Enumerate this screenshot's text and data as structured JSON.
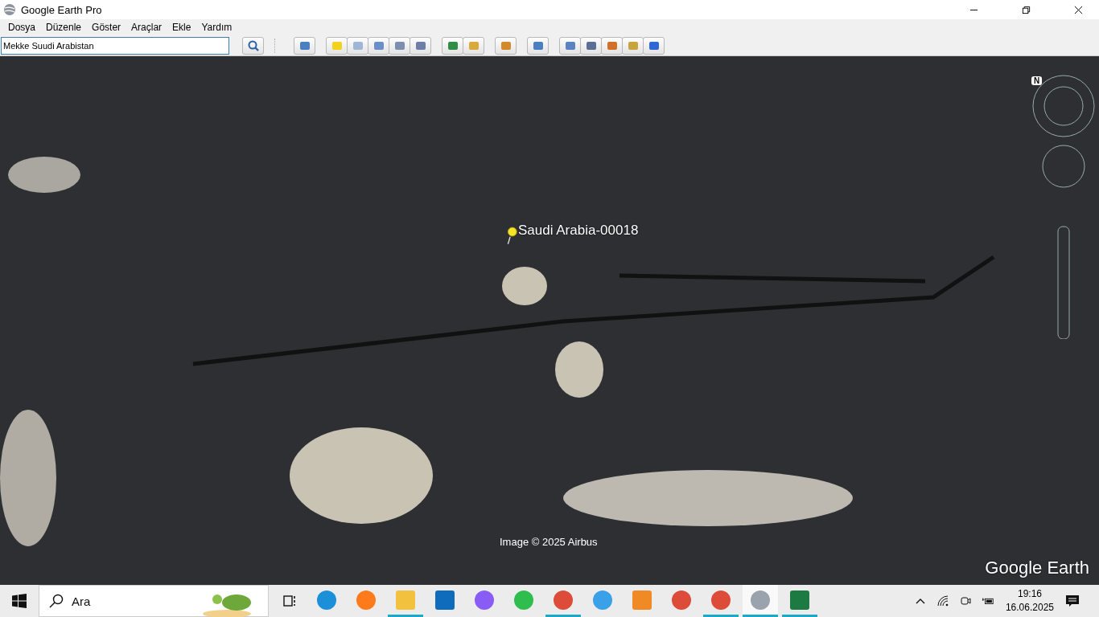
{
  "window": {
    "title": "Google Earth Pro"
  },
  "menu": [
    {
      "label": "Dosya"
    },
    {
      "label": "Düzenle"
    },
    {
      "label": "Göster"
    },
    {
      "label": "Araçlar"
    },
    {
      "label": "Ekle"
    },
    {
      "label": "Yardım"
    }
  ],
  "search": {
    "value": "Mekke Suudi Arabistan"
  },
  "map": {
    "placemark": {
      "label": "Saudi Arabia-00018"
    },
    "attribution": "Image © 2025 Airbus",
    "logo": "Google Earth",
    "compass": "N"
  },
  "taskbar": {
    "search_placeholder": "Ara",
    "time": "19:16",
    "date": "16.06.2025",
    "apps": [
      {
        "kind": "edge",
        "running": false,
        "selected": false
      },
      {
        "kind": "firefox",
        "running": false,
        "selected": false
      },
      {
        "kind": "folder",
        "running": true,
        "selected": false
      },
      {
        "kind": "outlook",
        "running": false,
        "selected": false
      },
      {
        "kind": "copilot",
        "running": false,
        "selected": false
      },
      {
        "kind": "whatsapp",
        "running": false,
        "selected": false
      },
      {
        "kind": "chrome",
        "running": true,
        "selected": false
      },
      {
        "kind": "ie",
        "running": false,
        "selected": false
      },
      {
        "kind": "media",
        "running": false,
        "selected": false
      },
      {
        "kind": "chrome",
        "running": false,
        "selected": false
      },
      {
        "kind": "chrome",
        "running": true,
        "selected": false
      },
      {
        "kind": "earth",
        "running": true,
        "selected": true
      },
      {
        "kind": "excel",
        "running": true,
        "selected": false
      }
    ]
  }
}
